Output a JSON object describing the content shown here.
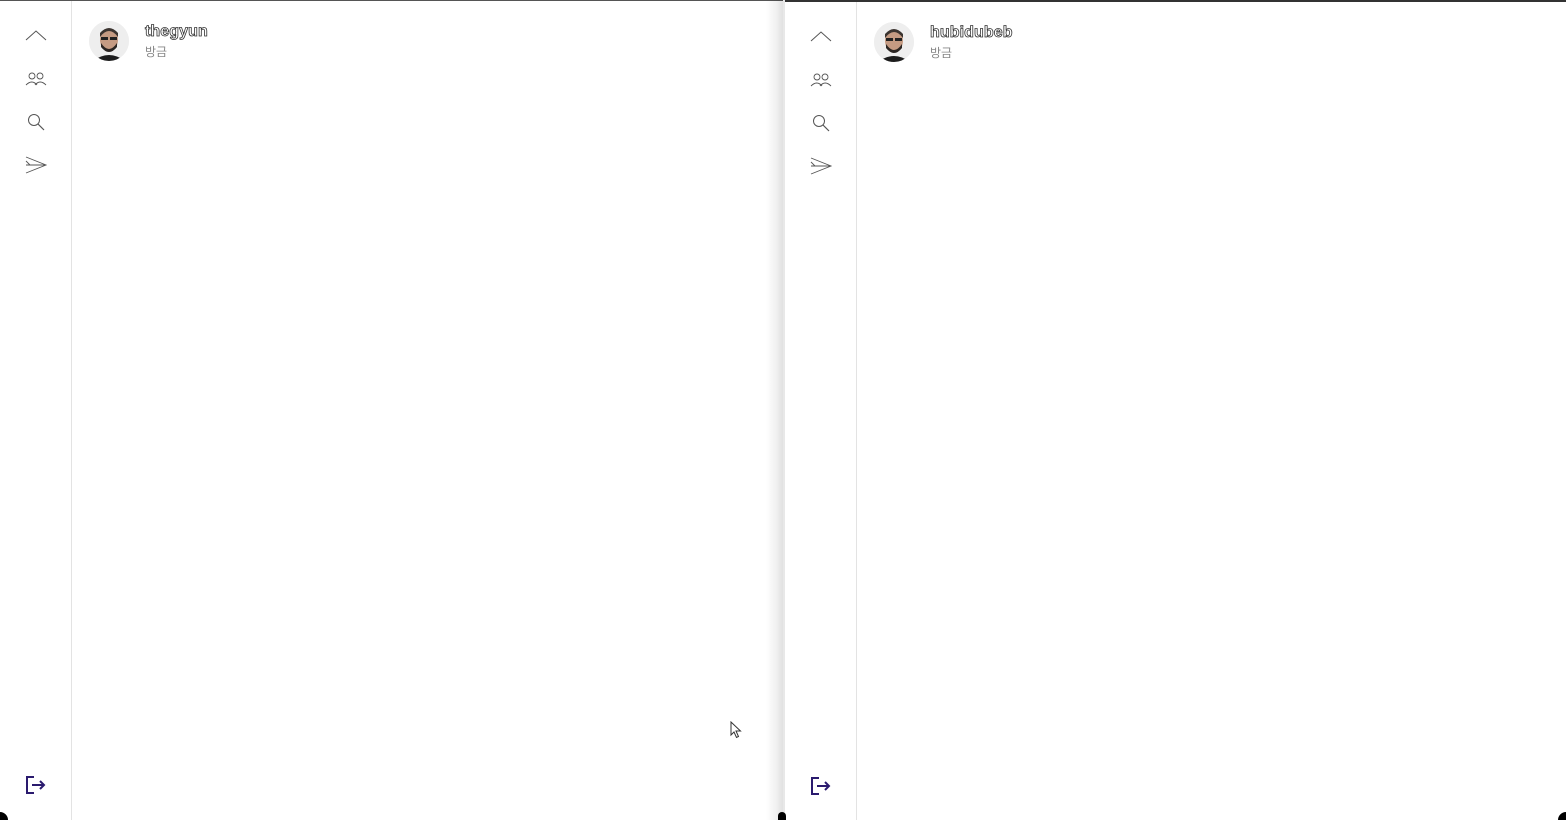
{
  "panes": [
    {
      "post": {
        "username": "thegyun",
        "timestamp": "방금"
      },
      "nav": {
        "collapse_icon": "chevron-up-icon",
        "people_icon": "people-icon",
        "search_icon": "search-icon",
        "send_icon": "send-icon",
        "logout_icon": "logout-icon"
      }
    },
    {
      "post": {
        "username": "hubidubeb",
        "timestamp": "방금"
      },
      "nav": {
        "collapse_icon": "chevron-up-icon",
        "people_icon": "people-icon",
        "search_icon": "search-icon",
        "send_icon": "send-icon",
        "logout_icon": "logout-icon"
      }
    }
  ],
  "colors": {
    "logout_accent": "#2a1a6e",
    "icon_stroke": "#555555",
    "timestamp": "#888888",
    "divider": "#e3e3e3"
  }
}
